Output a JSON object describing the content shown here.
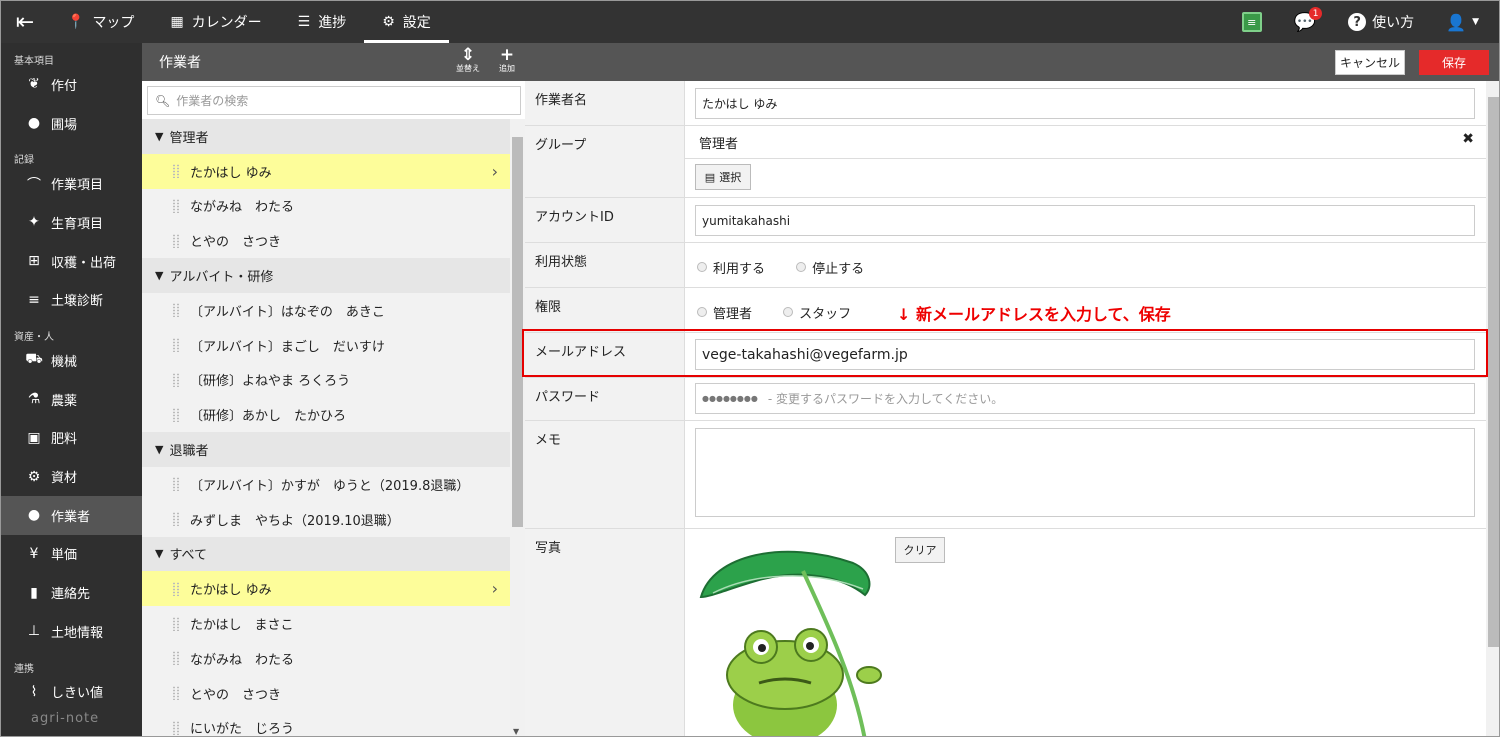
{
  "topbar": {
    "back_icon": "back-arrow-icon",
    "tabs": [
      {
        "icon": "map-pin-icon",
        "label": "マップ"
      },
      {
        "icon": "calendar-icon",
        "label": "カレンダー"
      },
      {
        "icon": "checklist-icon",
        "label": "進捗"
      },
      {
        "icon": "gear-icon",
        "label": "設定"
      }
    ],
    "active_tab": "設定",
    "notification_count": "1",
    "help_label": "使い方"
  },
  "sidebar": {
    "sections": [
      {
        "title": "基本項目",
        "items": [
          {
            "icon": "sprout-icon",
            "label": "作付"
          },
          {
            "icon": "pin-icon",
            "label": "圃場"
          }
        ]
      },
      {
        "title": "記録",
        "items": [
          {
            "icon": "hoe-icon",
            "label": "作業項目"
          },
          {
            "icon": "growth-icon",
            "label": "生育項目"
          },
          {
            "icon": "basket-icon",
            "label": "収穫・出荷"
          },
          {
            "icon": "sliders-icon",
            "label": "土壌診断"
          }
        ]
      },
      {
        "title": "資産・人",
        "items": [
          {
            "icon": "tractor-icon",
            "label": "機械"
          },
          {
            "icon": "flask-icon",
            "label": "農薬"
          },
          {
            "icon": "npk-icon",
            "label": "肥料"
          },
          {
            "icon": "material-icon",
            "label": "資材"
          },
          {
            "icon": "user-icon",
            "label": "作業者"
          },
          {
            "icon": "money-bag-icon",
            "label": "単価"
          },
          {
            "icon": "phone-icon",
            "label": "連絡先"
          },
          {
            "icon": "land-icon",
            "label": "土地情報"
          }
        ]
      },
      {
        "title": "連携",
        "items": [
          {
            "icon": "line-chart-icon",
            "label": "しきい値"
          }
        ]
      }
    ],
    "active_item": "作業者",
    "logo": "agri-note"
  },
  "list_panel": {
    "title": "作業者",
    "sort_label": "並替え",
    "add_label": "追加",
    "search_placeholder": "作業者の検索",
    "groups": [
      {
        "name": "管理者",
        "rows": [
          "たかはし ゆみ",
          "ながみね　わたる",
          "とやの　さつき"
        ]
      },
      {
        "name": "アルバイト・研修",
        "rows": [
          "〔アルバイト〕はなぞの　あきこ",
          "〔アルバイト〕まごし　だいすけ",
          "〔研修〕よねやま ろくろう",
          "〔研修〕あかし　たかひろ"
        ]
      },
      {
        "name": "退職者",
        "rows": [
          "〔アルバイト〕かすが　ゆうと（2019.8退職）",
          "みずしま　やちよ（2019.10退職）"
        ]
      },
      {
        "name": "すべて",
        "rows": [
          "たかはし ゆみ",
          "たかはし　まさこ",
          "ながみね　わたる",
          "とやの　さつき",
          "にいがた　じろう"
        ]
      }
    ],
    "selected": "たかはし ゆみ"
  },
  "form": {
    "cancel_label": "キャンセル",
    "save_label": "保存",
    "worker_name_label": "作業者名",
    "worker_name_value": "たかはし ゆみ",
    "group_label": "グループ",
    "group_value": "管理者",
    "select_button": "選択",
    "account_label": "アカウントID",
    "account_value": "yumitakahashi",
    "status_label": "利用状態",
    "status_options": [
      "利用する",
      "停止する"
    ],
    "role_label": "権限",
    "role_options": [
      "管理者",
      "スタッフ"
    ],
    "email_label": "メールアドレス",
    "email_value": "vege-takahashi@vegefarm.jp",
    "password_label": "パスワード",
    "password_mask": "●●●●●●●●",
    "password_hint": "- 変更するパスワードを入力してください。",
    "memo_label": "メモ",
    "photo_label": "写真",
    "clear_button": "クリア"
  },
  "annotation": "↓ 新メールアドレスを入力して、保存",
  "colors": {
    "topbar": "#333333",
    "sidebar": "#2f2f2f",
    "selected_row": "#fdfd9a",
    "save_button": "#e52a2a",
    "highlight": "#e60000"
  }
}
